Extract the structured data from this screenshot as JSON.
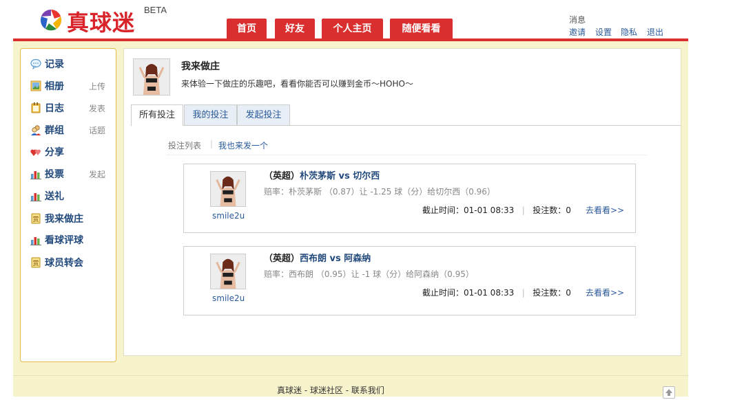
{
  "header": {
    "logo_text": "真球迷",
    "logo_badge": "BETA",
    "nav": [
      {
        "label": "首页"
      },
      {
        "label": "好友"
      },
      {
        "label": "个人主页"
      },
      {
        "label": "随便看看"
      }
    ],
    "messages_label": "消息",
    "links": [
      {
        "label": "邀请"
      },
      {
        "label": "设置"
      },
      {
        "label": "隐私"
      },
      {
        "label": "退出"
      }
    ]
  },
  "sidebar": {
    "items": [
      {
        "label": "记录",
        "action": "",
        "icon": "speech-bubble-icon"
      },
      {
        "label": "相册",
        "action": "上传",
        "icon": "photo-icon"
      },
      {
        "label": "日志",
        "action": "发表",
        "icon": "notebook-icon"
      },
      {
        "label": "群组",
        "action": "话题",
        "icon": "group-icon"
      },
      {
        "label": "分享",
        "action": "",
        "icon": "hearts-icon"
      },
      {
        "label": "投票",
        "action": "发起",
        "icon": "bar-chart-icon"
      },
      {
        "label": "送礼",
        "action": "",
        "icon": "gift-icon"
      },
      {
        "label": "我来做庄",
        "action": "",
        "icon": "reward-icon"
      },
      {
        "label": "看球评球",
        "action": "",
        "icon": "bar-chart-icon"
      },
      {
        "label": "球员转会",
        "action": "",
        "icon": "reward-icon"
      }
    ]
  },
  "main": {
    "title": "我来做庄",
    "description": "来体验一下做庄的乐趣吧，看看你能否可以赚到金币～HOHO～",
    "tabs": [
      {
        "label": "所有投注",
        "active": true
      },
      {
        "label": "我的投注",
        "active": false
      },
      {
        "label": "发起投注",
        "active": false
      }
    ],
    "subnav": {
      "list_label": "投注列表",
      "separator": "|",
      "new_label": "我也来发一个"
    },
    "bets": [
      {
        "user": "smile2u",
        "league": "（英超）",
        "match": "朴茨茅斯  vs 切尔西",
        "odds": "赔率：朴茨茅斯 （0.87）让 -1.25 球（分）给切尔西（0.96）",
        "deadline": "截止时间：01-01 08:33",
        "bet_count": "投注数：0",
        "link": "去看看>>"
      },
      {
        "user": "smile2u",
        "league": "（英超）",
        "match": "西布朗  vs 阿森纳",
        "odds": "赔率：西布朗 （0.95）让 -1 球（分）给阿森纳（0.95）",
        "deadline": "截止时间：01-01 08:33",
        "bet_count": "投注数：0",
        "link": "去看看>>"
      }
    ]
  },
  "footer": {
    "text": "真球迷  - 球迷社区  - 联系我们"
  },
  "colors": {
    "brand_red": "#d92f2f",
    "link_blue": "#2a5a9a",
    "page_bg": "#f7f3cc",
    "sidebar_border": "#e8b94a"
  }
}
